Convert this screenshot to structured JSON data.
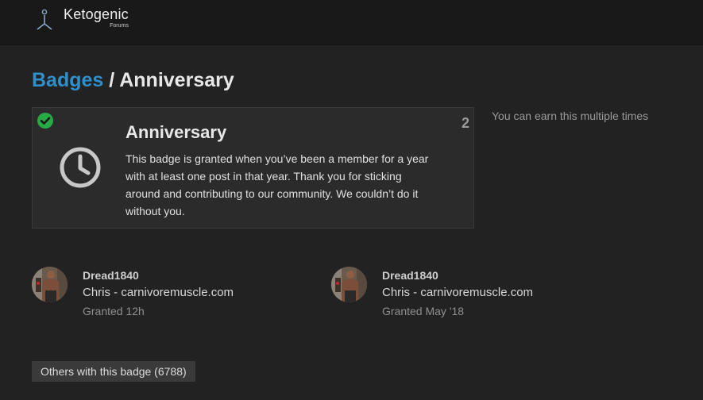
{
  "header": {
    "logo_name": "Ketogenic",
    "logo_sub": "Forums",
    "logo_icon": "keto-figure-icon"
  },
  "breadcrumb": {
    "parent": "Badges",
    "separator": " / ",
    "current": "Anniversary"
  },
  "badge": {
    "title": "Anniversary",
    "description": "This badge is granted when you’ve been a member for a year with at least one post in that year. Thank you for sticking around and contributing to our community. We couldn’t do it without you.",
    "grant_count": "2",
    "icon": "clock-icon",
    "status_icon": "check-circle-icon",
    "status_color": "#27a944"
  },
  "earn_note": "You can earn this multiple times",
  "grants": [
    {
      "username": "Dread1840",
      "title": "Chris - carnivoremuscle.com",
      "granted": "Granted 12h"
    },
    {
      "username": "Dread1840",
      "title": "Chris - carnivoremuscle.com",
      "granted": "Granted May '18"
    }
  ],
  "others_button": "Others with this badge (6788)",
  "colors": {
    "background": "#222222",
    "header": "#191919",
    "link": "#2e8fcb",
    "card": "#2b2b2b"
  }
}
